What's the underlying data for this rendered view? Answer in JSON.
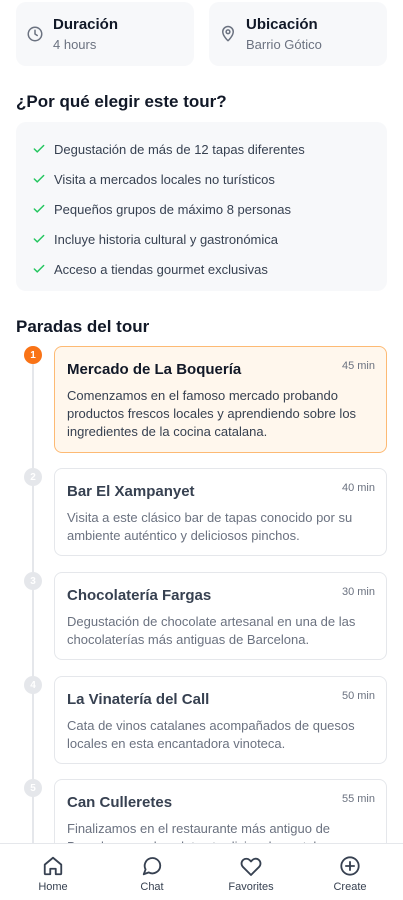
{
  "info": {
    "duration": {
      "title": "Duración",
      "value": "4 hours",
      "icon": "clock-icon"
    },
    "location": {
      "title": "Ubicación",
      "value": "Barrio Gótico",
      "icon": "map-pin-icon"
    }
  },
  "why": {
    "title": "¿Por qué elegir este tour?",
    "items": [
      "Degustación de más de 12 tapas diferentes",
      "Visita a mercados locales no turísticos",
      "Pequeños grupos de máximo 8 personas",
      "Incluye historia cultural y gastronómica",
      "Acceso a tiendas gourmet exclusivas"
    ]
  },
  "stops": {
    "title": "Paradas del tour",
    "items": [
      {
        "num": "1",
        "name": "Mercado de La Boquería",
        "duration": "45 min",
        "description": "Comenzamos en el famoso mercado probando productos frescos locales y aprendiendo sobre los ingredientes de la cocina catalana."
      },
      {
        "num": "2",
        "name": "Bar El Xampanyet",
        "duration": "40 min",
        "description": "Visita a este clásico bar de tapas conocido por su ambiente auténtico y deliciosos pinchos."
      },
      {
        "num": "3",
        "name": "Chocolatería Fargas",
        "duration": "30 min",
        "description": "Degustación de chocolate artesanal en una de las chocolaterías más antiguas de Barcelona."
      },
      {
        "num": "4",
        "name": "La Vinatería del Call",
        "duration": "50 min",
        "description": "Cata de vinos catalanes acompañados de quesos locales en esta encantadora vinoteca."
      },
      {
        "num": "5",
        "name": "Can Culleretes",
        "duration": "55 min",
        "description": "Finalizamos en el restaurante más antiguo de Barcelona con los platos tradicionales catalanes."
      }
    ]
  },
  "nav": {
    "home": "Home",
    "chat": "Chat",
    "favorites": "Favorites",
    "create": "Create"
  },
  "colors": {
    "accent": "#f97316",
    "check": "#22c55e",
    "active_card_bg": "#fff7ed",
    "active_card_border": "#fdba74"
  }
}
